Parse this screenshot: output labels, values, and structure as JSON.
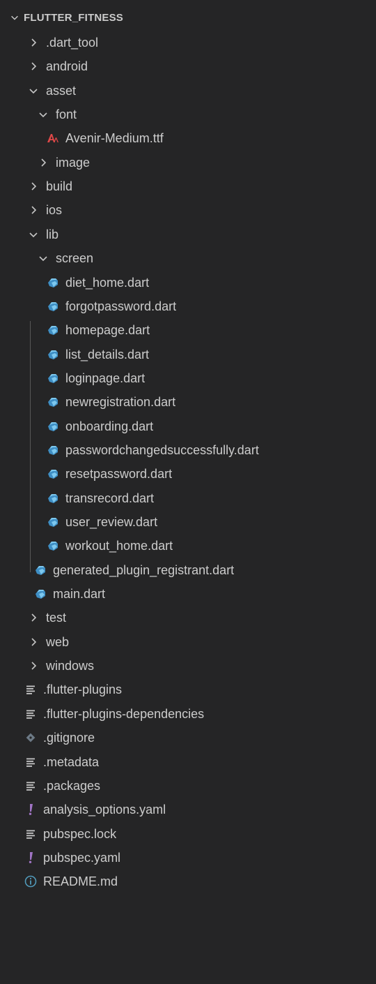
{
  "explorer": {
    "section_title": "FLUTTER_FITNESS",
    "items": [
      {
        "label": ".dart_tool",
        "type": "folder",
        "expanded": false,
        "depth": 1,
        "icon": "chevron-right-icon"
      },
      {
        "label": "android",
        "type": "folder",
        "expanded": false,
        "depth": 1,
        "icon": "chevron-right-icon"
      },
      {
        "label": "asset",
        "type": "folder",
        "expanded": true,
        "depth": 1,
        "icon": "chevron-down-icon"
      },
      {
        "label": "font",
        "type": "folder",
        "expanded": true,
        "depth": 2,
        "icon": "chevron-down-icon"
      },
      {
        "label": "Avenir-Medium.ttf",
        "type": "file",
        "depth": 3,
        "icon": "font-file-icon"
      },
      {
        "label": "image",
        "type": "folder",
        "expanded": false,
        "depth": 2,
        "icon": "chevron-right-icon"
      },
      {
        "label": "build",
        "type": "folder",
        "expanded": false,
        "depth": 1,
        "icon": "chevron-right-icon"
      },
      {
        "label": "ios",
        "type": "folder",
        "expanded": false,
        "depth": 1,
        "icon": "chevron-right-icon"
      },
      {
        "label": "lib",
        "type": "folder",
        "expanded": true,
        "depth": 1,
        "icon": "chevron-down-icon"
      },
      {
        "label": "screen",
        "type": "folder",
        "expanded": true,
        "depth": 2,
        "icon": "chevron-down-icon"
      },
      {
        "label": "diet_home.dart",
        "type": "file",
        "depth": 3,
        "icon": "dart-file-icon"
      },
      {
        "label": "forgotpassword.dart",
        "type": "file",
        "depth": 3,
        "icon": "dart-file-icon"
      },
      {
        "label": "homepage.dart",
        "type": "file",
        "depth": 3,
        "icon": "dart-file-icon"
      },
      {
        "label": "list_details.dart",
        "type": "file",
        "depth": 3,
        "icon": "dart-file-icon"
      },
      {
        "label": "loginpage.dart",
        "type": "file",
        "depth": 3,
        "icon": "dart-file-icon"
      },
      {
        "label": "newregistration.dart",
        "type": "file",
        "depth": 3,
        "icon": "dart-file-icon"
      },
      {
        "label": "onboarding.dart",
        "type": "file",
        "depth": 3,
        "icon": "dart-file-icon"
      },
      {
        "label": "passwordchangedsuccessfully.dart",
        "type": "file",
        "depth": 3,
        "icon": "dart-file-icon"
      },
      {
        "label": "resetpassword.dart",
        "type": "file",
        "depth": 3,
        "icon": "dart-file-icon"
      },
      {
        "label": "transrecord.dart",
        "type": "file",
        "depth": 3,
        "icon": "dart-file-icon"
      },
      {
        "label": "user_review.dart",
        "type": "file",
        "depth": 3,
        "icon": "dart-file-icon"
      },
      {
        "label": "workout_home.dart",
        "type": "file",
        "depth": 3,
        "icon": "dart-file-icon"
      },
      {
        "label": "generated_plugin_registrant.dart",
        "type": "file",
        "depth": 2,
        "icon": "dart-file-icon"
      },
      {
        "label": "main.dart",
        "type": "file",
        "depth": 2,
        "icon": "dart-file-icon"
      },
      {
        "label": "test",
        "type": "folder",
        "expanded": false,
        "depth": 1,
        "icon": "chevron-right-icon"
      },
      {
        "label": "web",
        "type": "folder",
        "expanded": false,
        "depth": 1,
        "icon": "chevron-right-icon"
      },
      {
        "label": "windows",
        "type": "folder",
        "expanded": false,
        "depth": 1,
        "icon": "chevron-right-icon"
      },
      {
        "label": ".flutter-plugins",
        "type": "file",
        "depth": 1,
        "icon": "text-lines-icon"
      },
      {
        "label": ".flutter-plugins-dependencies",
        "type": "file",
        "depth": 1,
        "icon": "text-lines-icon"
      },
      {
        "label": ".gitignore",
        "type": "file",
        "depth": 1,
        "icon": "git-diamond-icon"
      },
      {
        "label": ".metadata",
        "type": "file",
        "depth": 1,
        "icon": "text-lines-icon"
      },
      {
        "label": ".packages",
        "type": "file",
        "depth": 1,
        "icon": "text-lines-icon"
      },
      {
        "label": "analysis_options.yaml",
        "type": "file",
        "depth": 1,
        "icon": "yaml-exclamation-icon"
      },
      {
        "label": "pubspec.lock",
        "type": "file",
        "depth": 1,
        "icon": "text-lines-icon"
      },
      {
        "label": "pubspec.yaml",
        "type": "file",
        "depth": 1,
        "icon": "yaml-exclamation-icon"
      },
      {
        "label": "README.md",
        "type": "file",
        "depth": 1,
        "icon": "info-circle-icon"
      }
    ]
  },
  "colors": {
    "background": "#252526",
    "text": "#cccccc",
    "icon_gray": "#c5c5c5",
    "dart_blue_light": "#7dc8ee",
    "dart_blue_dark": "#3e8ec4",
    "font_icon_red": "#e04848",
    "yaml_purple": "#a074c4",
    "info_blue": "#519aba",
    "gitignore_gray": "#6d7a86",
    "indent_guide": "#585858"
  }
}
